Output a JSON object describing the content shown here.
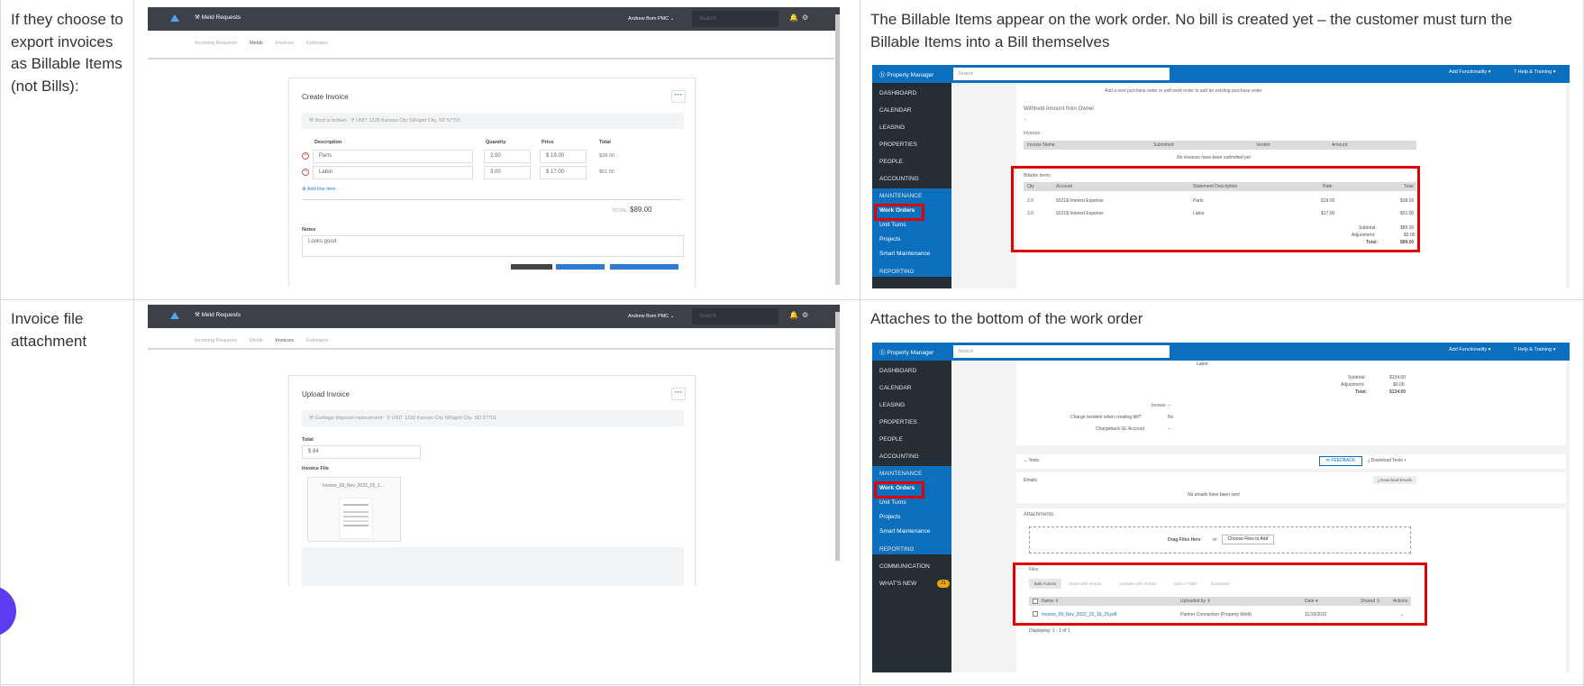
{
  "rows": [
    {
      "label": "If they choose to export invoices as Billable Items (not Bills):",
      "note": "The Billable Items appear on the work order. No bill is created yet – the customer must turn the Billable Items into a Bill themselves"
    },
    {
      "label": "Invoice file attachment",
      "note": "Attaches to the bottom of the work order"
    }
  ],
  "meld": {
    "app_title": "Meld Requests",
    "user": "Andrew Bom PMC",
    "search_placeholder": "Search",
    "tabs": [
      "Incoming Requests",
      "Melds",
      "Invoices",
      "Estimates"
    ],
    "create": {
      "title": "Create Invoice",
      "meld_name": "Roof is broken",
      "address": "UNIT 1228 Kansas City SiRapid City, SD 57701",
      "col_description": "Description",
      "col_quantity": "Quantity",
      "col_price": "Price",
      "col_total": "Total",
      "items": [
        {
          "description": "Parts",
          "quantity": "2.00",
          "price": "$ 19.00",
          "total": "$38.00"
        },
        {
          "description": "Labor",
          "quantity": "3.00",
          "price": "$ 17.00",
          "total": "$51.00"
        }
      ],
      "add_line": "Add line item",
      "total_label": "TOTAL",
      "total_value": "$89.00",
      "notes_label": "Notes",
      "notes_value": "Looks good"
    },
    "upload": {
      "title": "Upload Invoice",
      "meld_name": "Garbage disposal replacement",
      "address": "UNIT 1228 Kansas City SiRapid City, SD 57701",
      "total_label": "Total",
      "total_value": "$ 84",
      "file_label": "Invoice File",
      "file_name": "Invoice_09_Nov_2022_15_1..."
    }
  },
  "pm": {
    "brand": "Property Manager",
    "search_placeholder": "Search",
    "add_functionality": "Add Functionality",
    "help": "Help & Training",
    "nav": [
      "DASHBOARD",
      "CALENDAR",
      "LEASING",
      "PROPERTIES",
      "PEOPLE",
      "ACCOUNTING",
      "MAINTENANCE"
    ],
    "nav_after": [
      "REPORTING",
      "COMMUNICATION",
      "WHAT'S NEW"
    ],
    "whats_new_badge": "21",
    "sub": [
      "Work Orders",
      "Unit Turns",
      "Projects",
      "Smart Maintenance"
    ],
    "wo1": {
      "po_hint": "Add a new purchase order or edit work order to add an existing purchase order",
      "withheld": "Withheld Amount from Owner",
      "withheld_value": "--",
      "invoices": "Invoices",
      "inv_cols": [
        "Invoice Name",
        "Submitted",
        "Vendor",
        "Amount"
      ],
      "no_invoices": "No invoices have been submitted yet",
      "billable": "Billable Items",
      "cols": [
        "Qty",
        "Account",
        "Statement Description",
        "Rate",
        "Total"
      ],
      "rows": [
        [
          "2.0",
          "9221$ Interest Expense",
          "Parts",
          "$19.00",
          "$38.00"
        ],
        [
          "3.0",
          "9221$ Interest Expense",
          "Labor",
          "$17.00",
          "$51.00"
        ]
      ],
      "subtotal_label": "Subtotal:",
      "subtotal": "$89.00",
      "adjustment_label": "Adjustment:",
      "adjustment": "$0.00",
      "total_label": "Total:",
      "total": "$89.00"
    },
    "wo2": {
      "row_text": "Labor",
      "subtotal_label": "Subtotal:",
      "subtotal": "$134.00",
      "adjustment_label": "Adjustment:",
      "adjustment": "$0.00",
      "total_label": "Total:",
      "total": "$134.00",
      "invoice_label": "Invoice",
      "invoice_value": "--",
      "charge_label": "Charge resident when creating bill?",
      "charge_value": "No",
      "gl_label": "Chargeback GL Account",
      "gl_value": "--",
      "texts": "Texts",
      "feedback": "FEEDBACK",
      "download_texts": "Download Texts",
      "emails": "Emails",
      "download_emails": "Download Emails",
      "no_emails": "No emails have been sent",
      "attachments": "Attachments",
      "drag": "Drag Files Here",
      "or": "or",
      "choose": "Choose Files to Add",
      "files": "Files",
      "actions": [
        "Bulk Actions",
        "Share with Vendor",
        "Unshare with Vendor",
        "Add to Folder",
        "Download"
      ],
      "cols": [
        "Name",
        "Uploaded by",
        "Date",
        "Shared",
        "Actions"
      ],
      "file_name": "Invoice_09_Nov_2022_15_19_29.pdf",
      "uploaded_by": "Partner Connection (Property Meld)",
      "date": "11/10/2022",
      "displaying": "Displaying: 1 - 1 of 1"
    }
  },
  "colors": {
    "pm_blue": "#0c6fbe",
    "pm_sidebar": "#232e37",
    "meld_bar": "#3d4147",
    "highlight": "#e00000"
  }
}
